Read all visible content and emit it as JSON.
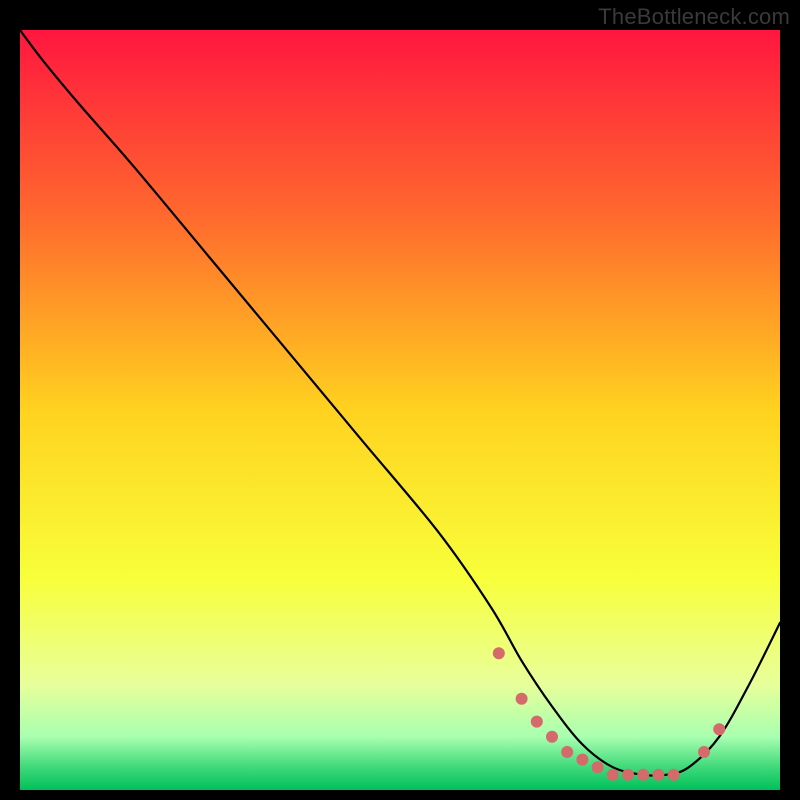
{
  "watermark": "TheBottleneck.com",
  "chart_data": {
    "type": "line",
    "title": "",
    "xlabel": "",
    "ylabel": "",
    "xlim": [
      0,
      100
    ],
    "ylim": [
      0,
      100
    ],
    "gradient_stops": [
      {
        "offset": 0,
        "color": "#ff163f"
      },
      {
        "offset": 25,
        "color": "#ff6b2d"
      },
      {
        "offset": 50,
        "color": "#ffd21f"
      },
      {
        "offset": 72,
        "color": "#f8ff3a"
      },
      {
        "offset": 86,
        "color": "#e8ff9a"
      },
      {
        "offset": 93,
        "color": "#a8ffb0"
      },
      {
        "offset": 97,
        "color": "#3fd97a"
      },
      {
        "offset": 100,
        "color": "#00c05a"
      }
    ],
    "series": [
      {
        "name": "curve",
        "x": [
          0,
          3,
          8,
          15,
          25,
          35,
          45,
          55,
          62,
          66,
          70,
          74,
          78,
          82,
          85,
          88,
          92,
          96,
          100
        ],
        "y": [
          100,
          96,
          90,
          82,
          70,
          58,
          46,
          34,
          24,
          17,
          11,
          6,
          3,
          2,
          2,
          3,
          7,
          14,
          22
        ]
      }
    ],
    "markers": {
      "name": "flat-region-dots",
      "color": "#d46a6a",
      "radius": 6,
      "x": [
        63,
        66,
        68,
        70,
        72,
        74,
        76,
        78,
        80,
        82,
        84,
        86,
        90,
        92
      ],
      "y": [
        18,
        12,
        9,
        7,
        5,
        4,
        3,
        2,
        2,
        2,
        2,
        2,
        5,
        8
      ]
    }
  }
}
